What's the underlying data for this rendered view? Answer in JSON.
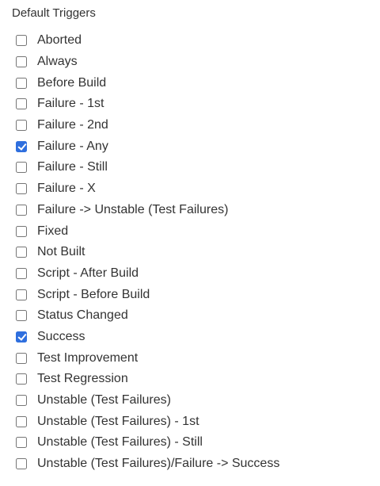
{
  "section": {
    "title": "Default Triggers"
  },
  "triggers": [
    {
      "label": "Aborted",
      "checked": false
    },
    {
      "label": "Always",
      "checked": false
    },
    {
      "label": "Before Build",
      "checked": false
    },
    {
      "label": "Failure - 1st",
      "checked": false
    },
    {
      "label": "Failure - 2nd",
      "checked": false
    },
    {
      "label": "Failure - Any",
      "checked": true
    },
    {
      "label": "Failure - Still",
      "checked": false
    },
    {
      "label": "Failure - X",
      "checked": false
    },
    {
      "label": "Failure -> Unstable (Test Failures)",
      "checked": false
    },
    {
      "label": "Fixed",
      "checked": false
    },
    {
      "label": "Not Built",
      "checked": false
    },
    {
      "label": "Script - After Build",
      "checked": false
    },
    {
      "label": "Script - Before Build",
      "checked": false
    },
    {
      "label": "Status Changed",
      "checked": false
    },
    {
      "label": "Success",
      "checked": true
    },
    {
      "label": "Test Improvement",
      "checked": false
    },
    {
      "label": "Test Regression",
      "checked": false
    },
    {
      "label": "Unstable (Test Failures)",
      "checked": false
    },
    {
      "label": "Unstable (Test Failures) - 1st",
      "checked": false
    },
    {
      "label": "Unstable (Test Failures) - Still",
      "checked": false
    },
    {
      "label": "Unstable (Test Failures)/Failure -> Success",
      "checked": false
    }
  ],
  "colors": {
    "checkbox_checked": "#2f6fde",
    "text": "#333333"
  }
}
